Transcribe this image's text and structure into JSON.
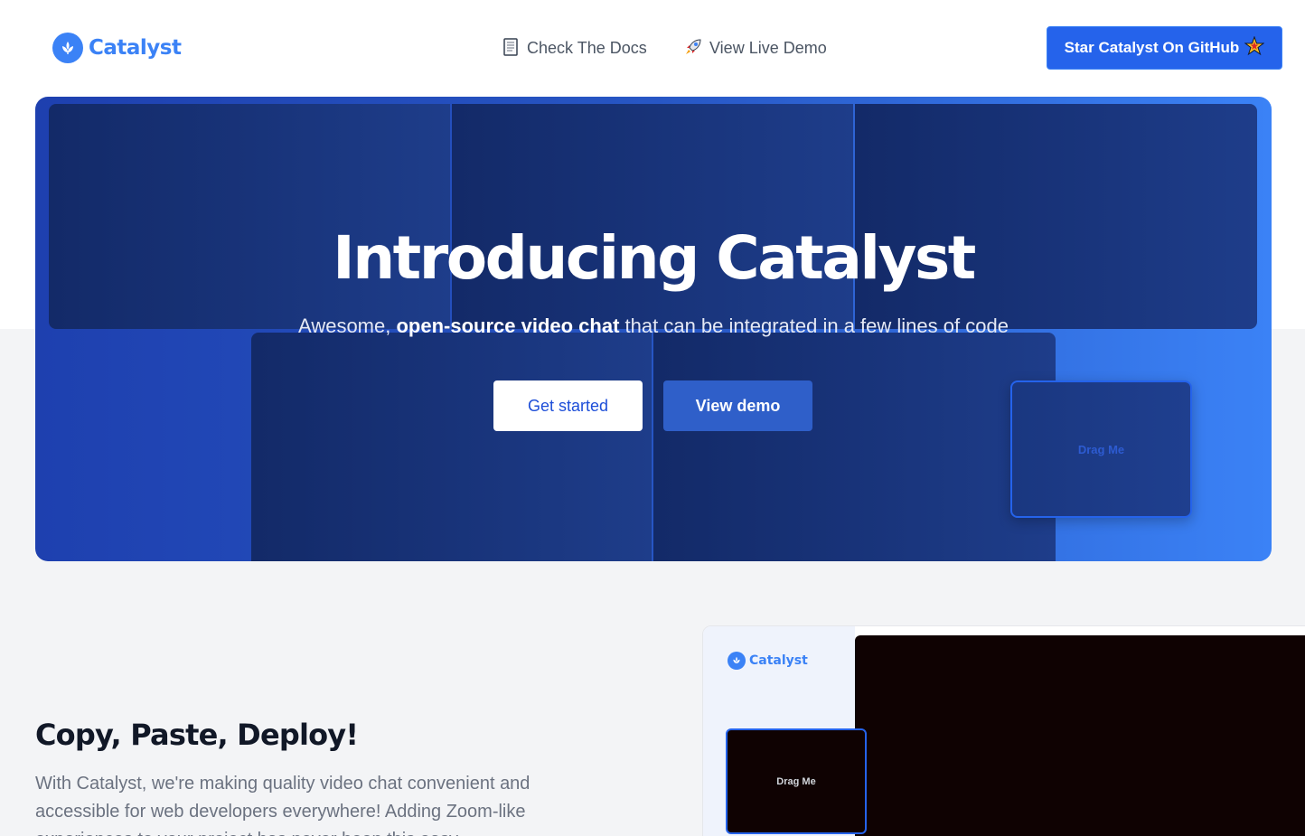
{
  "nav": {
    "brand": "Catalyst",
    "links": [
      {
        "icon": "book-icon",
        "label": "Check The Docs"
      },
      {
        "icon": "rocket-icon",
        "label": "View Live Demo"
      }
    ],
    "github_button": "Star Catalyst On GitHub",
    "github_icon": "star-icon"
  },
  "hero": {
    "title": "Introducing Catalyst",
    "subtitle_pre": "Awesome, ",
    "subtitle_bold": "open-source video chat",
    "subtitle_post": " that can be integrated in a few lines of code",
    "primary_button": "Get started",
    "secondary_button": "View demo",
    "drag_label": "Drag Me"
  },
  "feature": {
    "title": "Copy, Paste, Deploy!",
    "body": "With Catalyst, we're making quality video chat convenient and accessible for web developers everywhere! Adding Zoom-like experiences to your project has never been this easy."
  },
  "preview": {
    "brand": "Catalyst",
    "drag_label": "Drag Me"
  },
  "colors": {
    "accent": "#3b82f6",
    "button_primary": "#2563eb",
    "hero_dark": "#1e3a8a",
    "video_bg": "#0f0202"
  }
}
